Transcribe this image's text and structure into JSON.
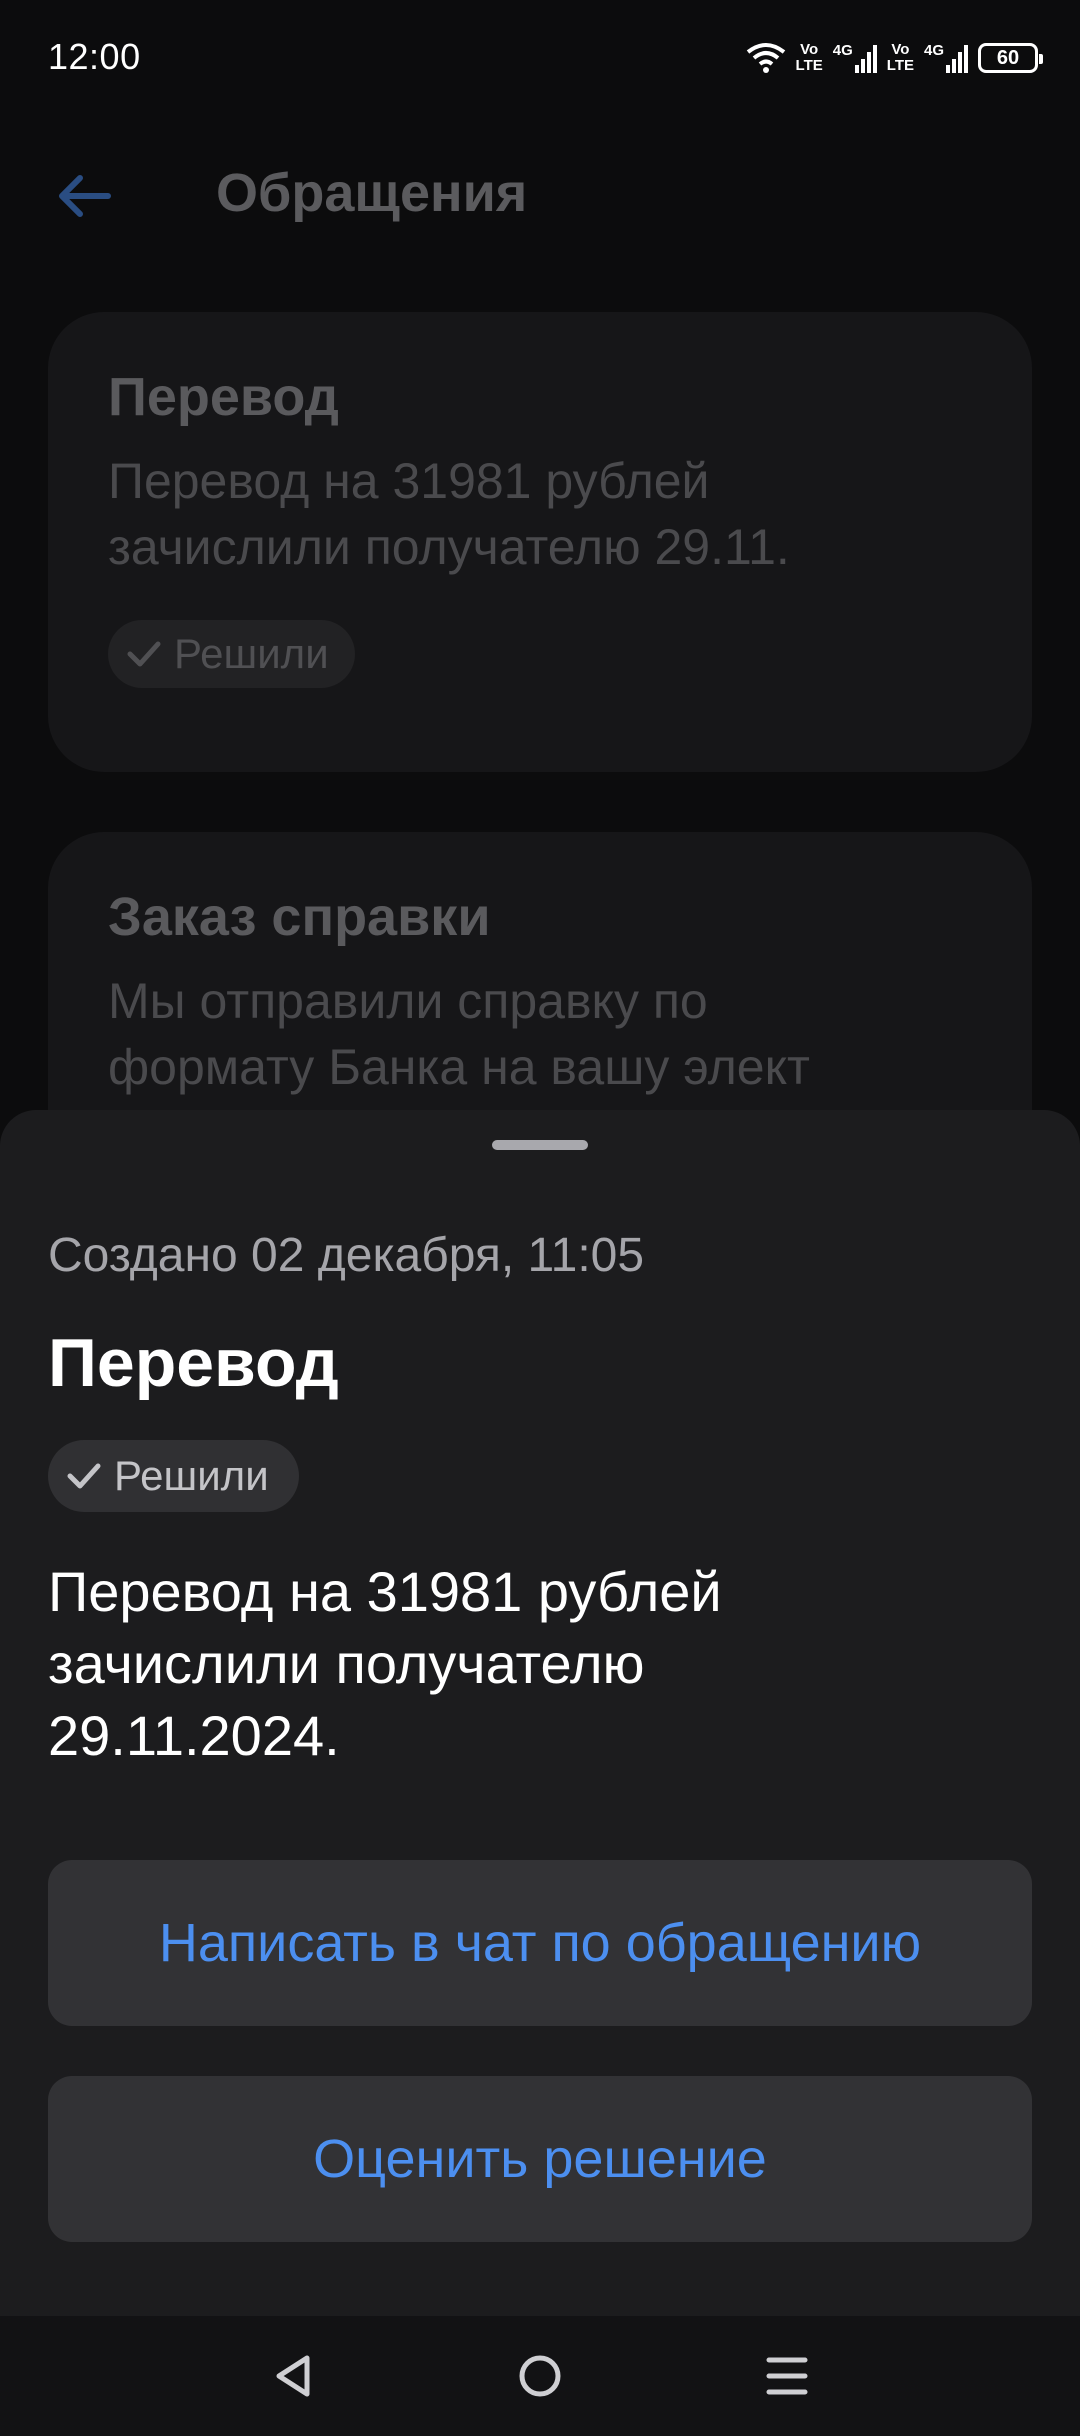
{
  "status_bar": {
    "time": "12:00",
    "sim1": [
      "Vo",
      "LTE"
    ],
    "sim1_net": "4G",
    "sim2": [
      "Vo",
      "LTE"
    ],
    "sim2_net": "4G",
    "battery": "60",
    "icons": [
      "wifi-icon",
      "signal-icon",
      "battery-icon"
    ]
  },
  "header": {
    "title": "Обращения",
    "back_icon": "arrow-left-icon"
  },
  "list": [
    {
      "title": "Перевод",
      "text_line1": "Перевод на 31981 рублей",
      "text_line2": "зачислили получателю 29.11.",
      "status": "Решили"
    },
    {
      "title": "Заказ справки",
      "text_line1": "Мы отправили справку по",
      "text_line2": "формату Банка на вашу элект"
    }
  ],
  "sheet": {
    "created": "Создано 02 декабря, 11:05",
    "title": "Перевод",
    "status": "Решили",
    "body": "Перевод на 31981 рублей зачислили получателю 29.11.2024.",
    "chat_button": "Написать в чат по обращению",
    "rate_button": "Оценить решение"
  },
  "colors": {
    "accent": "#4c8ff0",
    "sheet_bg": "#1c1c1e",
    "button_bg": "#323235"
  }
}
